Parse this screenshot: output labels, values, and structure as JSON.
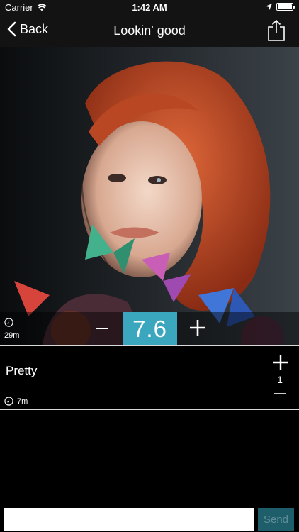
{
  "status_bar": {
    "carrier": "Carrier",
    "time": "1:42 AM",
    "battery_level": 1.0
  },
  "nav": {
    "back_label": "Back",
    "title": "Lookin' good"
  },
  "photo": {
    "subject": "portrait"
  },
  "rating": {
    "score": "7.6",
    "elapsed": "29m",
    "minus_symbol": "−",
    "plus_symbol": "+"
  },
  "comments": [
    {
      "text": "Pretty",
      "time": "7m",
      "votes": "1"
    }
  ],
  "input": {
    "placeholder": "",
    "send_label": "Send"
  },
  "colors": {
    "accent": "#3aa7bf",
    "send_bg": "#1e5e6a",
    "bar_bg": "#131313"
  }
}
